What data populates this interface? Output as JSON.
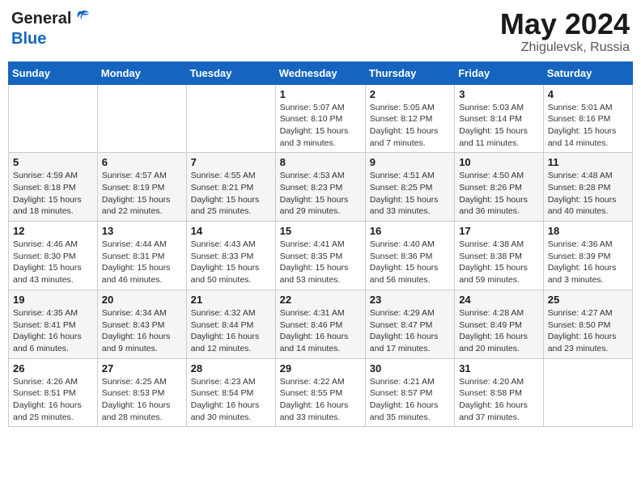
{
  "header": {
    "logo_general": "General",
    "logo_blue": "Blue",
    "title": "May 2024",
    "location": "Zhigulevsk, Russia"
  },
  "days_of_week": [
    "Sunday",
    "Monday",
    "Tuesday",
    "Wednesday",
    "Thursday",
    "Friday",
    "Saturday"
  ],
  "weeks": [
    [
      {
        "day": "",
        "info": ""
      },
      {
        "day": "",
        "info": ""
      },
      {
        "day": "",
        "info": ""
      },
      {
        "day": "1",
        "info": "Sunrise: 5:07 AM\nSunset: 8:10 PM\nDaylight: 15 hours\nand 3 minutes."
      },
      {
        "day": "2",
        "info": "Sunrise: 5:05 AM\nSunset: 8:12 PM\nDaylight: 15 hours\nand 7 minutes."
      },
      {
        "day": "3",
        "info": "Sunrise: 5:03 AM\nSunset: 8:14 PM\nDaylight: 15 hours\nand 11 minutes."
      },
      {
        "day": "4",
        "info": "Sunrise: 5:01 AM\nSunset: 8:16 PM\nDaylight: 15 hours\nand 14 minutes."
      }
    ],
    [
      {
        "day": "5",
        "info": "Sunrise: 4:59 AM\nSunset: 8:18 PM\nDaylight: 15 hours\nand 18 minutes."
      },
      {
        "day": "6",
        "info": "Sunrise: 4:57 AM\nSunset: 8:19 PM\nDaylight: 15 hours\nand 22 minutes."
      },
      {
        "day": "7",
        "info": "Sunrise: 4:55 AM\nSunset: 8:21 PM\nDaylight: 15 hours\nand 25 minutes."
      },
      {
        "day": "8",
        "info": "Sunrise: 4:53 AM\nSunset: 8:23 PM\nDaylight: 15 hours\nand 29 minutes."
      },
      {
        "day": "9",
        "info": "Sunrise: 4:51 AM\nSunset: 8:25 PM\nDaylight: 15 hours\nand 33 minutes."
      },
      {
        "day": "10",
        "info": "Sunrise: 4:50 AM\nSunset: 8:26 PM\nDaylight: 15 hours\nand 36 minutes."
      },
      {
        "day": "11",
        "info": "Sunrise: 4:48 AM\nSunset: 8:28 PM\nDaylight: 15 hours\nand 40 minutes."
      }
    ],
    [
      {
        "day": "12",
        "info": "Sunrise: 4:46 AM\nSunset: 8:30 PM\nDaylight: 15 hours\nand 43 minutes."
      },
      {
        "day": "13",
        "info": "Sunrise: 4:44 AM\nSunset: 8:31 PM\nDaylight: 15 hours\nand 46 minutes."
      },
      {
        "day": "14",
        "info": "Sunrise: 4:43 AM\nSunset: 8:33 PM\nDaylight: 15 hours\nand 50 minutes."
      },
      {
        "day": "15",
        "info": "Sunrise: 4:41 AM\nSunset: 8:35 PM\nDaylight: 15 hours\nand 53 minutes."
      },
      {
        "day": "16",
        "info": "Sunrise: 4:40 AM\nSunset: 8:36 PM\nDaylight: 15 hours\nand 56 minutes."
      },
      {
        "day": "17",
        "info": "Sunrise: 4:38 AM\nSunset: 8:38 PM\nDaylight: 15 hours\nand 59 minutes."
      },
      {
        "day": "18",
        "info": "Sunrise: 4:36 AM\nSunset: 8:39 PM\nDaylight: 16 hours\nand 3 minutes."
      }
    ],
    [
      {
        "day": "19",
        "info": "Sunrise: 4:35 AM\nSunset: 8:41 PM\nDaylight: 16 hours\nand 6 minutes."
      },
      {
        "day": "20",
        "info": "Sunrise: 4:34 AM\nSunset: 8:43 PM\nDaylight: 16 hours\nand 9 minutes."
      },
      {
        "day": "21",
        "info": "Sunrise: 4:32 AM\nSunset: 8:44 PM\nDaylight: 16 hours\nand 12 minutes."
      },
      {
        "day": "22",
        "info": "Sunrise: 4:31 AM\nSunset: 8:46 PM\nDaylight: 16 hours\nand 14 minutes."
      },
      {
        "day": "23",
        "info": "Sunrise: 4:29 AM\nSunset: 8:47 PM\nDaylight: 16 hours\nand 17 minutes."
      },
      {
        "day": "24",
        "info": "Sunrise: 4:28 AM\nSunset: 8:49 PM\nDaylight: 16 hours\nand 20 minutes."
      },
      {
        "day": "25",
        "info": "Sunrise: 4:27 AM\nSunset: 8:50 PM\nDaylight: 16 hours\nand 23 minutes."
      }
    ],
    [
      {
        "day": "26",
        "info": "Sunrise: 4:26 AM\nSunset: 8:51 PM\nDaylight: 16 hours\nand 25 minutes."
      },
      {
        "day": "27",
        "info": "Sunrise: 4:25 AM\nSunset: 8:53 PM\nDaylight: 16 hours\nand 28 minutes."
      },
      {
        "day": "28",
        "info": "Sunrise: 4:23 AM\nSunset: 8:54 PM\nDaylight: 16 hours\nand 30 minutes."
      },
      {
        "day": "29",
        "info": "Sunrise: 4:22 AM\nSunset: 8:55 PM\nDaylight: 16 hours\nand 33 minutes."
      },
      {
        "day": "30",
        "info": "Sunrise: 4:21 AM\nSunset: 8:57 PM\nDaylight: 16 hours\nand 35 minutes."
      },
      {
        "day": "31",
        "info": "Sunrise: 4:20 AM\nSunset: 8:58 PM\nDaylight: 16 hours\nand 37 minutes."
      },
      {
        "day": "",
        "info": ""
      }
    ]
  ]
}
